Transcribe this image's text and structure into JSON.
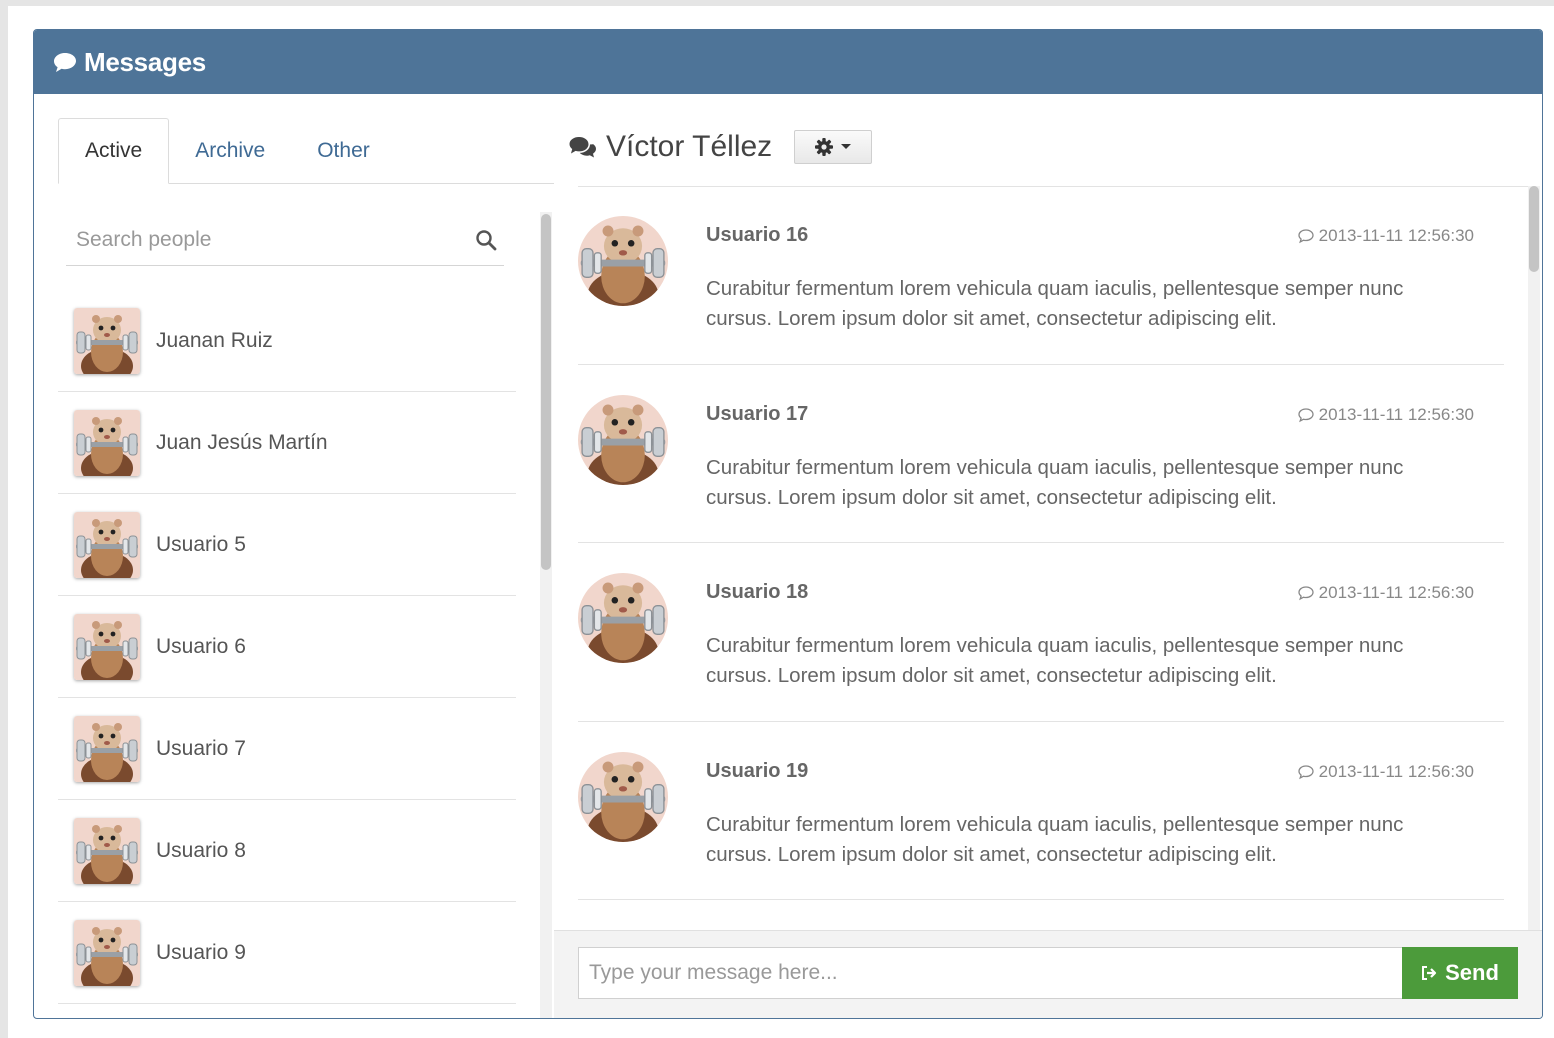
{
  "header": {
    "title": "Messages",
    "icon": "chat-bubble-icon"
  },
  "tabs": [
    {
      "label": "Active",
      "active": true
    },
    {
      "label": "Archive",
      "active": false
    },
    {
      "label": "Other",
      "active": false
    }
  ],
  "search": {
    "placeholder": "Search people",
    "value": ""
  },
  "people": [
    {
      "name": "Juanan Ruiz"
    },
    {
      "name": "Juan Jesús Martín"
    },
    {
      "name": "Usuario 5"
    },
    {
      "name": "Usuario 6"
    },
    {
      "name": "Usuario 7"
    },
    {
      "name": "Usuario 8"
    },
    {
      "name": "Usuario 9"
    }
  ],
  "conversation": {
    "title": "Víctor Téllez",
    "settings_icon": "gear-icon"
  },
  "messages": [
    {
      "user": "Usuario 16",
      "time": "2013-11-11 12:56:30",
      "text": "Curabitur fermentum lorem vehicula quam iaculis, pellentesque semper nunc cursus. Lorem ipsum dolor sit amet, consectetur adipiscing elit."
    },
    {
      "user": "Usuario 17",
      "time": "2013-11-11 12:56:30",
      "text": "Curabitur fermentum lorem vehicula quam iaculis, pellentesque semper nunc cursus. Lorem ipsum dolor sit amet, consectetur adipiscing elit."
    },
    {
      "user": "Usuario 18",
      "time": "2013-11-11 12:56:30",
      "text": "Curabitur fermentum lorem vehicula quam iaculis, pellentesque semper nunc cursus. Lorem ipsum dolor sit amet, consectetur adipiscing elit."
    },
    {
      "user": "Usuario 19",
      "time": "2013-11-11 12:56:30",
      "text": "Curabitur fermentum lorem vehicula quam iaculis, pellentesque semper nunc cursus. Lorem ipsum dolor sit amet, consectetur adipiscing elit."
    }
  ],
  "composer": {
    "placeholder": "Type your message here...",
    "value": "",
    "send_label": "Send"
  },
  "colors": {
    "header": "#4e7498",
    "link": "#3f6a94",
    "send": "#4c9b3b"
  }
}
